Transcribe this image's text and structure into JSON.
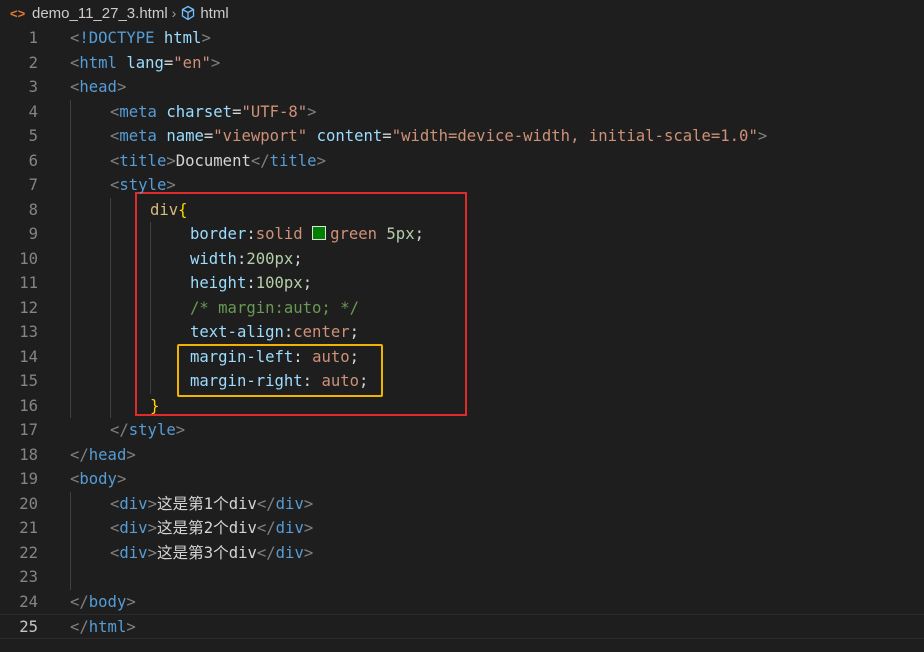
{
  "breadcrumb": {
    "file_icon": "<>",
    "file": "demo_11_27_3.html",
    "separator": "›",
    "symbol_icon": "html-symbol-icon",
    "symbol": "html"
  },
  "colors": {
    "background": "#1e1e1e",
    "tag": "#569cd6",
    "attribute": "#9cdcfe",
    "string": "#ce9178",
    "selector": "#d7ba7d",
    "number": "#b5cea8",
    "comment": "#6a9955",
    "brace": "#ffd700",
    "swatch_green": "#008000",
    "highlight_red": "#e02b2b",
    "highlight_yellow": "#f0b400"
  },
  "current_line": 25,
  "lines": [
    {
      "n": "1",
      "indent": 0,
      "tokens": [
        [
          "p",
          "<"
        ],
        [
          "tag",
          "!DOCTYPE"
        ],
        [
          "txt",
          " "
        ],
        [
          "attr",
          "html"
        ],
        [
          "p",
          ">"
        ]
      ]
    },
    {
      "n": "2",
      "indent": 0,
      "tokens": [
        [
          "p",
          "<"
        ],
        [
          "tag",
          "html"
        ],
        [
          "txt",
          " "
        ],
        [
          "attr",
          "lang"
        ],
        [
          "txt",
          "="
        ],
        [
          "str",
          "\"en\""
        ],
        [
          "p",
          ">"
        ]
      ]
    },
    {
      "n": "3",
      "indent": 0,
      "tokens": [
        [
          "p",
          "<"
        ],
        [
          "tag",
          "head"
        ],
        [
          "p",
          ">"
        ]
      ]
    },
    {
      "n": "4",
      "indent": 1,
      "tokens": [
        [
          "p",
          "<"
        ],
        [
          "tag",
          "meta"
        ],
        [
          "txt",
          " "
        ],
        [
          "attr",
          "charset"
        ],
        [
          "txt",
          "="
        ],
        [
          "str",
          "\"UTF-8\""
        ],
        [
          "p",
          ">"
        ]
      ]
    },
    {
      "n": "5",
      "indent": 1,
      "tokens": [
        [
          "p",
          "<"
        ],
        [
          "tag",
          "meta"
        ],
        [
          "txt",
          " "
        ],
        [
          "attr",
          "name"
        ],
        [
          "txt",
          "="
        ],
        [
          "str",
          "\"viewport\""
        ],
        [
          "txt",
          " "
        ],
        [
          "attr",
          "content"
        ],
        [
          "txt",
          "="
        ],
        [
          "str",
          "\"width=device-width, initial-scale=1.0\""
        ],
        [
          "p",
          ">"
        ]
      ]
    },
    {
      "n": "6",
      "indent": 1,
      "tokens": [
        [
          "p",
          "<"
        ],
        [
          "tag",
          "title"
        ],
        [
          "p",
          ">"
        ],
        [
          "txt",
          "Document"
        ],
        [
          "p",
          "</"
        ],
        [
          "tag",
          "title"
        ],
        [
          "p",
          ">"
        ]
      ]
    },
    {
      "n": "7",
      "indent": 1,
      "tokens": [
        [
          "p",
          "<"
        ],
        [
          "tag",
          "style"
        ],
        [
          "p",
          ">"
        ]
      ]
    },
    {
      "n": "8",
      "indent": 2,
      "tokens": [
        [
          "sel",
          "div"
        ],
        [
          "brace",
          "{"
        ]
      ]
    },
    {
      "n": "9",
      "indent": 3,
      "tokens": [
        [
          "prop",
          "border"
        ],
        [
          "txt",
          ":"
        ],
        [
          "val",
          "solid "
        ],
        [
          "swatch",
          "#008000"
        ],
        [
          "val",
          "green "
        ],
        [
          "num",
          "5px"
        ],
        [
          "txt",
          ";"
        ]
      ]
    },
    {
      "n": "10",
      "indent": 3,
      "tokens": [
        [
          "prop",
          "width"
        ],
        [
          "txt",
          ":"
        ],
        [
          "num",
          "200px"
        ],
        [
          "txt",
          ";"
        ]
      ]
    },
    {
      "n": "11",
      "indent": 3,
      "tokens": [
        [
          "prop",
          "height"
        ],
        [
          "txt",
          ":"
        ],
        [
          "num",
          "100px"
        ],
        [
          "txt",
          ";"
        ]
      ]
    },
    {
      "n": "12",
      "indent": 3,
      "tokens": [
        [
          "com",
          "/* margin:auto; */"
        ]
      ]
    },
    {
      "n": "13",
      "indent": 3,
      "tokens": [
        [
          "prop",
          "text-align"
        ],
        [
          "txt",
          ":"
        ],
        [
          "val",
          "center"
        ],
        [
          "txt",
          ";"
        ]
      ]
    },
    {
      "n": "14",
      "indent": 3,
      "tokens": [
        [
          "prop",
          "margin-left"
        ],
        [
          "txt",
          ": "
        ],
        [
          "val",
          "auto"
        ],
        [
          "txt",
          ";"
        ]
      ]
    },
    {
      "n": "15",
      "indent": 3,
      "tokens": [
        [
          "prop",
          "margin-right"
        ],
        [
          "txt",
          ": "
        ],
        [
          "val",
          "auto"
        ],
        [
          "txt",
          ";"
        ]
      ]
    },
    {
      "n": "16",
      "indent": 2,
      "tokens": [
        [
          "brace",
          "}"
        ]
      ]
    },
    {
      "n": "17",
      "indent": 1,
      "tokens": [
        [
          "p",
          "</"
        ],
        [
          "tag",
          "style"
        ],
        [
          "p",
          ">"
        ]
      ]
    },
    {
      "n": "18",
      "indent": 0,
      "tokens": [
        [
          "p",
          "</"
        ],
        [
          "tag",
          "head"
        ],
        [
          "p",
          ">"
        ]
      ]
    },
    {
      "n": "19",
      "indent": 0,
      "tokens": [
        [
          "p",
          "<"
        ],
        [
          "tag",
          "body"
        ],
        [
          "p",
          ">"
        ]
      ]
    },
    {
      "n": "20",
      "indent": 1,
      "tokens": [
        [
          "p",
          "<"
        ],
        [
          "tag",
          "div"
        ],
        [
          "p",
          ">"
        ],
        [
          "txt",
          "这是第1个div"
        ],
        [
          "p",
          "</"
        ],
        [
          "tag",
          "div"
        ],
        [
          "p",
          ">"
        ]
      ]
    },
    {
      "n": "21",
      "indent": 1,
      "tokens": [
        [
          "p",
          "<"
        ],
        [
          "tag",
          "div"
        ],
        [
          "p",
          ">"
        ],
        [
          "txt",
          "这是第2个div"
        ],
        [
          "p",
          "</"
        ],
        [
          "tag",
          "div"
        ],
        [
          "p",
          ">"
        ]
      ]
    },
    {
      "n": "22",
      "indent": 1,
      "tokens": [
        [
          "p",
          "<"
        ],
        [
          "tag",
          "div"
        ],
        [
          "p",
          ">"
        ],
        [
          "txt",
          "这是第3个div"
        ],
        [
          "p",
          "</"
        ],
        [
          "tag",
          "div"
        ],
        [
          "p",
          ">"
        ]
      ]
    },
    {
      "n": "23",
      "indent": 0,
      "tokens": []
    },
    {
      "n": "24",
      "indent": 0,
      "tokens": [
        [
          "p",
          "</"
        ],
        [
          "tag",
          "body"
        ],
        [
          "p",
          ">"
        ]
      ]
    },
    {
      "n": "25",
      "indent": 0,
      "tokens": [
        [
          "p",
          "</"
        ],
        [
          "tag",
          "html"
        ],
        [
          "p",
          ">"
        ]
      ]
    }
  ]
}
